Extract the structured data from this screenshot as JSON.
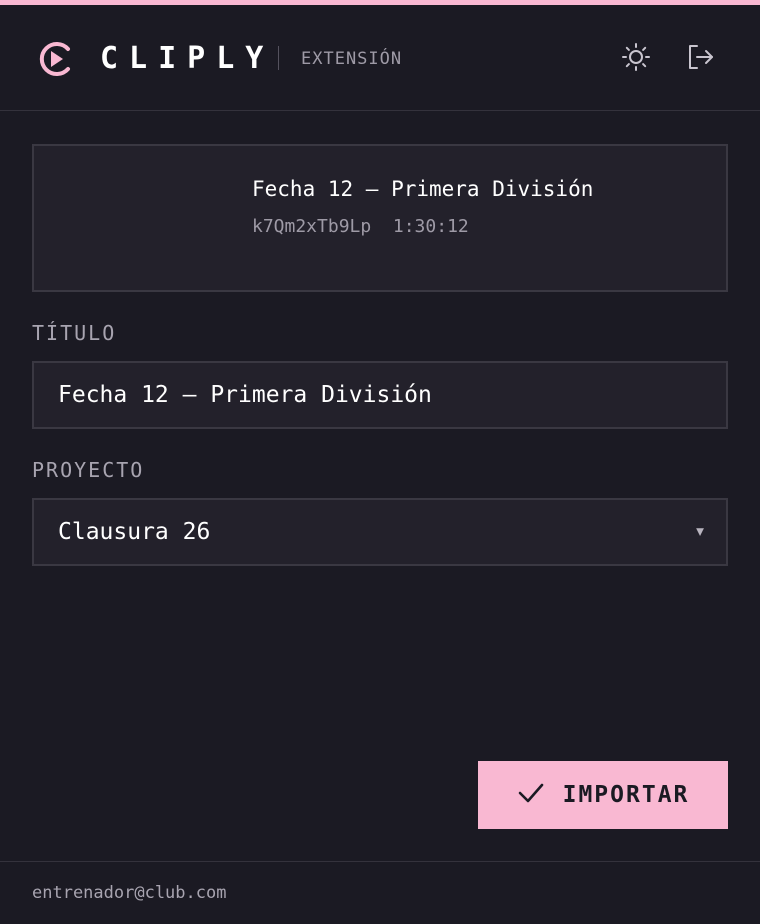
{
  "header": {
    "brand": "CLIPLY",
    "subtitle": "EXTENSIÓN",
    "icons": {
      "logo": "play-circle-icon",
      "theme": "sun-icon",
      "logout": "logout-icon"
    },
    "accent": "#f9b8d2"
  },
  "video": {
    "title": "Fecha 12 — Primera División",
    "meta": "k7Qm2xTb9Lp  1:30:12"
  },
  "form": {
    "title_label": "TÍTULO",
    "title_value": "Fecha 12 — Primera División",
    "project_label": "PROYECTO",
    "project_value": "Clausura 26"
  },
  "actions": {
    "import_label": "IMPORTAR",
    "import_icon": "check-icon"
  },
  "footer": {
    "email": "entrenador@club.com"
  }
}
